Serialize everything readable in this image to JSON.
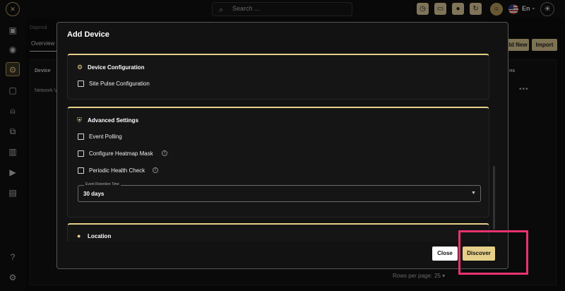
{
  "topbar": {
    "search_placeholder": "Search ...",
    "language": "En"
  },
  "background": {
    "breadcrumb": "Dapnod",
    "tab_overview": "Overview",
    "add_new_label": "Add New",
    "import_label": "Import",
    "table_header_device": "Device",
    "table_header_actions": "ns",
    "row_device": "Network V",
    "rows_per_page_label": "Rows per page:",
    "rows_per_page_value": "25"
  },
  "modal": {
    "title": "Add Device",
    "device_configuration": {
      "title": "Device Configuration",
      "items": [
        {
          "label": "Site Pulse Configuration",
          "checked": false
        }
      ]
    },
    "advanced_settings": {
      "title": "Advanced Settings",
      "items": [
        {
          "label": "Event Polling",
          "checked": false
        },
        {
          "label": "Configure Heatmap Mask",
          "checked": false
        },
        {
          "label": "Periodic Health Check",
          "checked": false
        }
      ],
      "retention": {
        "legend": "Event Retention Time",
        "value": "30 days"
      }
    },
    "location": {
      "title": "Location"
    },
    "close_label": "Close",
    "discover_label": "Discover"
  },
  "colors": {
    "accent_gold": "#e6cf88",
    "highlight_pink": "#e8336e"
  }
}
